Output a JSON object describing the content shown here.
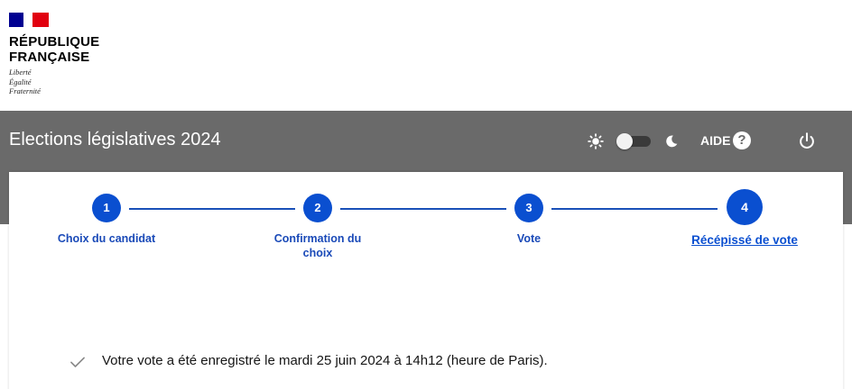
{
  "header": {
    "republic_line1": "RÉPUBLIQUE",
    "republic_line2": "FRANÇAISE",
    "motto": [
      "Liberté",
      "Égalité",
      "Fraternité"
    ]
  },
  "appbar": {
    "title": "Elections législatives 2024",
    "aide_label": "AIDE",
    "help_glyph": "?",
    "theme_toggle": "light",
    "icons": [
      "sun-icon",
      "moon-icon",
      "help-icon",
      "power-icon"
    ]
  },
  "stepper": {
    "steps": [
      {
        "number": "1",
        "label": "Choix du candidat"
      },
      {
        "number": "2",
        "label": "Confirmation du choix"
      },
      {
        "number": "3",
        "label": "Vote"
      },
      {
        "number": "4",
        "label": "Récépissé de vote"
      }
    ],
    "active_step": 4
  },
  "confirmation": {
    "message": "Votre vote a été enregistré le mardi 25 juin 2024 à 14h12 (heure de Paris)."
  },
  "colors": {
    "appbar": "#6a6a6a",
    "step_blue": "#0a4fd0",
    "flag_blue": "#000091",
    "flag_red": "#e1000f"
  }
}
